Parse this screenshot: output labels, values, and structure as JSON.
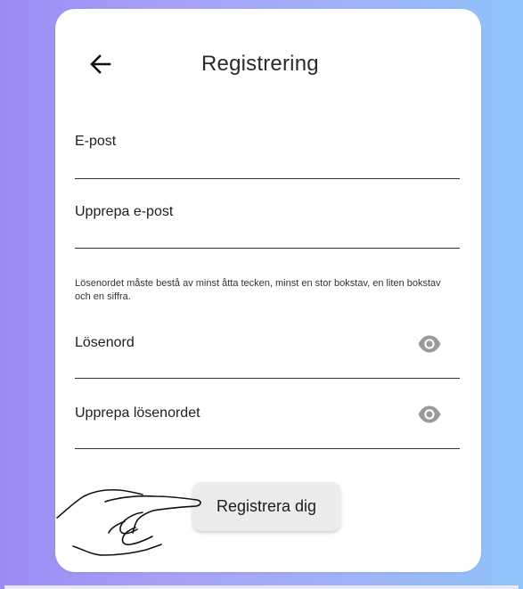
{
  "header": {
    "title": "Registrering",
    "back_icon": "arrow-left-icon"
  },
  "form": {
    "email_label": "E-post",
    "email_repeat_label": "Upprepa e-post",
    "password_hint": "Lösenordet måste bestå av minst åtta tecken, minst en stor bokstav, en liten bokstav och en siffra.",
    "password_label": "Lösenord",
    "password_repeat_label": "Upprepa lösenordet",
    "visibility_icon": "eye-icon"
  },
  "actions": {
    "register_label": "Registrera dig"
  },
  "colors": {
    "background_left": "#9b8cf5",
    "background_right": "#8ec3fb",
    "card": "#ffffff",
    "button": "#ececec",
    "eye_icon": "#9a9a9a"
  }
}
